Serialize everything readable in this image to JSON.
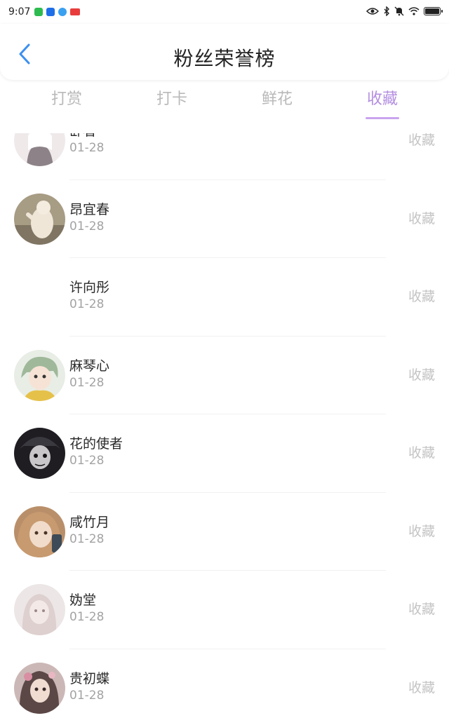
{
  "status_bar": {
    "time": "9:07"
  },
  "header": {
    "title": "粉丝荣誉榜"
  },
  "tabs": [
    {
      "label": "打赏",
      "active": false
    },
    {
      "label": "打卡",
      "active": false
    },
    {
      "label": "鲜花",
      "active": false
    },
    {
      "label": "收藏",
      "active": true
    }
  ],
  "list": {
    "items": [
      {
        "name": "卧看",
        "date": "01-28",
        "action": "收藏",
        "avatar": "anime girl in white dress"
      },
      {
        "name": "昂宜春",
        "date": "01-28",
        "action": "收藏",
        "avatar": "cat photo"
      },
      {
        "name": "许向彤",
        "date": "01-28",
        "action": "收藏",
        "avatar": ""
      },
      {
        "name": "麻琴心",
        "date": "01-28",
        "action": "收藏",
        "avatar": "anime character with green hair"
      },
      {
        "name": "花的使者",
        "date": "01-28",
        "action": "收藏",
        "avatar": "dark anime character"
      },
      {
        "name": "咸竹月",
        "date": "01-28",
        "action": "收藏",
        "avatar": "girl photo"
      },
      {
        "name": "妫堂",
        "date": "01-28",
        "action": "收藏",
        "avatar": "pale portrait"
      },
      {
        "name": "贵初蝶",
        "date": "01-28",
        "action": "收藏",
        "avatar": "girl with flowers"
      }
    ]
  },
  "colors": {
    "accent": "#b48ee0",
    "tab_inactive": "#b9b9b9",
    "action": "#c4c4c4",
    "date": "#a3a3a3",
    "back_arrow": "#3d8ff0"
  }
}
